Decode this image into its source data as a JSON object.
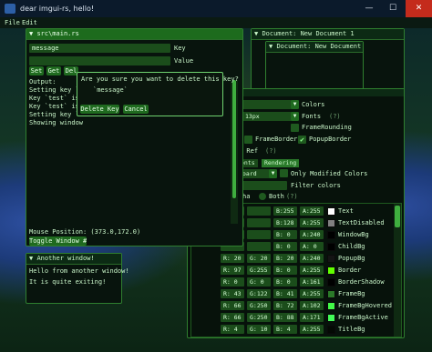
{
  "app": {
    "title": "dear imgui-rs, hello!"
  },
  "menu": {
    "file": "File",
    "edit": "Edit"
  },
  "window_controls": {
    "minimize": "—",
    "maximize": "☐",
    "close": "✕"
  },
  "main_window": {
    "title": "src\\main.rs",
    "key_input_value": "message",
    "key_label": "Key",
    "value_input_value": "",
    "value_label": "Value",
    "buttons": [
      "Set",
      "Get",
      "Del"
    ],
    "output_lines": [
      "Output:",
      "Setting key `m",
      "Key `test` is",
      "Key `test` is",
      "Setting key `t",
      "Showing window"
    ],
    "mouse_position": "Mouse Position: (373.0,172.0)",
    "toggle_button": "Toggle Window #2"
  },
  "confirm_popup": {
    "question": "Are you sure you want to delete this key?",
    "key": "`message`",
    "delete_button": "Delete Key",
    "cancel_button": "Cancel"
  },
  "another_window": {
    "title": "Another window!",
    "lines": [
      "Hello from another window!",
      "It is quite exiting!"
    ]
  },
  "doc1": {
    "title": "Document: New Document 1"
  },
  "doc2": {
    "title": "Document: New Document 2"
  },
  "style_editor": {
    "colors_label": "Colors",
    "fonts_value": "13px",
    "fonts_label": "Fonts",
    "help": "(?)",
    "frame_rounding": "FrameRounding",
    "frame_border": "FrameBorder",
    "popup_border": "PopupBorder",
    "ref_label": ": Ref",
    "tabs": [
      "onts",
      "Rendering"
    ],
    "board_value": "oard",
    "only_modified": "Only Modified Colors",
    "filter_label": "Filter colors",
    "alpha_label": "ha",
    "both_label": "Both",
    "color_rows": [
      {
        "r": "",
        "g": "",
        "b": "B:255",
        "a": "A:255",
        "name": "Text",
        "color": "#ffffff"
      },
      {
        "r": "",
        "g": "",
        "b": "B:128",
        "a": "A:255",
        "name": "TextDisabled",
        "color": "#808080"
      },
      {
        "r": "",
        "g": "",
        "b": "B:  0",
        "a": "A:240",
        "name": "WindowBg",
        "color": "#000000"
      },
      {
        "r": "",
        "g": "",
        "b": "B:  0",
        "a": "A:  0",
        "name": "ChildBg",
        "color": "#000000"
      },
      {
        "r": "R: 20",
        "g": "G: 20",
        "b": "B: 20",
        "a": "A:240",
        "name": "PopupBg",
        "color": "#141414"
      },
      {
        "r": "R: 97",
        "g": "G:255",
        "b": "B:  0",
        "a": "A:255",
        "name": "Border",
        "color": "#61ff00"
      },
      {
        "r": "R:  0",
        "g": "G:  0",
        "b": "B:  0",
        "a": "A:161",
        "name": "BorderShadow",
        "color": "#000000"
      },
      {
        "r": "R: 43",
        "g": "G:122",
        "b": "B: 41",
        "a": "A:255",
        "name": "FrameBg",
        "color": "#2b7a29"
      },
      {
        "r": "R: 66",
        "g": "G:250",
        "b": "B: 72",
        "a": "A:102",
        "name": "FrameBgHovered",
        "color": "#42fa48"
      },
      {
        "r": "R: 66",
        "g": "G:250",
        "b": "B: 88",
        "a": "A:171",
        "name": "FrameBgActive",
        "color": "#42fa58"
      },
      {
        "r": "R:  4",
        "g": "G: 10",
        "b": "B:  4",
        "a": "A:255",
        "name": "TitleBg",
        "color": "#040a04"
      }
    ]
  }
}
